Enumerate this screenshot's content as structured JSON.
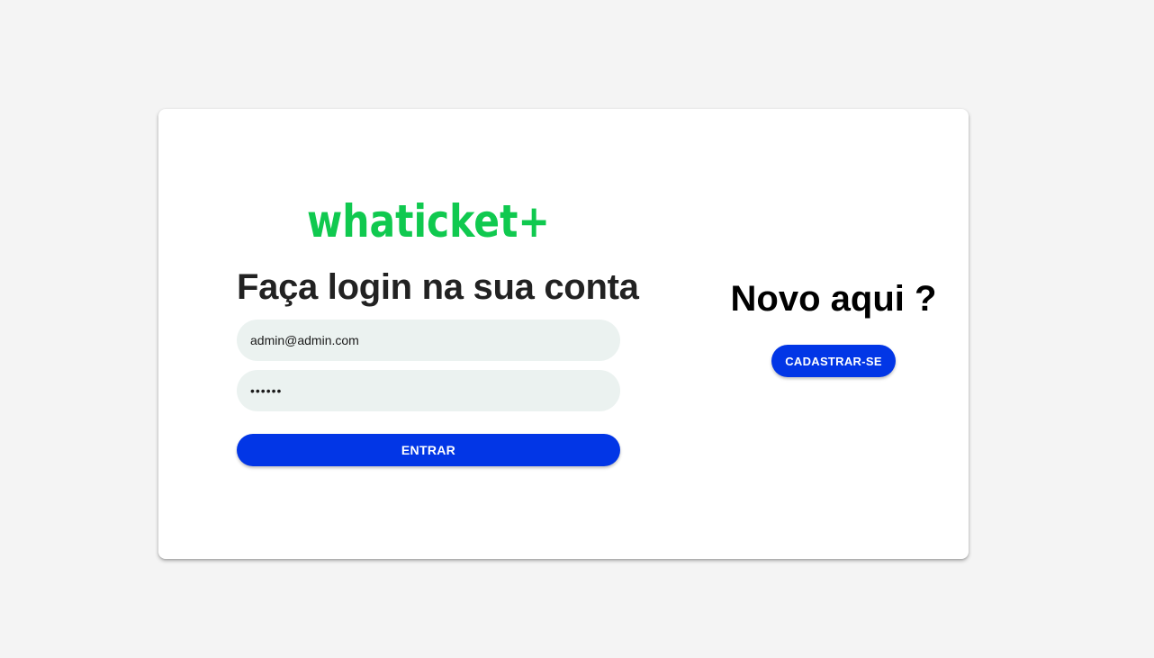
{
  "brand": {
    "logo_text": "whaticket+",
    "logo_color": "#10c94f"
  },
  "login": {
    "title": "Faça login na sua conta",
    "email_value": "admin@admin.com",
    "password_value": "••••••",
    "enter_label": "ENTRAR"
  },
  "signup": {
    "title": "Novo aqui ?",
    "button_label": "CADASTRAR-SE"
  },
  "colors": {
    "background": "#f4f4f4",
    "card": "#ffffff",
    "primary_button": "#0236e6",
    "input_bg": "#ebf2f0"
  }
}
